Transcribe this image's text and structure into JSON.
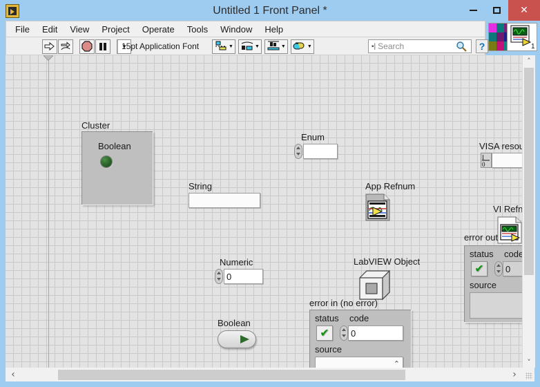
{
  "window": {
    "title": "Untitled 1 Front Panel *",
    "app_icon": "labview-vi-icon",
    "minimize": "–",
    "maximize": "□",
    "close": "✕"
  },
  "menu": {
    "items": [
      "File",
      "Edit",
      "View",
      "Project",
      "Operate",
      "Tools",
      "Window",
      "Help"
    ]
  },
  "toolbar": {
    "run_label": "run-arrow-icon",
    "run_continuous_label": "run-continuously-icon",
    "abort_label": "abort-execution-icon",
    "pause_label": "pause-icon",
    "font_selector": "15pt Application Font",
    "font_caret": "▼",
    "align_objects": "align-objects-icon",
    "distribute_objects": "distribute-objects-icon",
    "resize_objects": "resize-objects-icon",
    "reorder_objects": "reorder-objects-icon",
    "search": {
      "placeholder": "Search",
      "icon": "magnifier-icon"
    },
    "help_button": "?",
    "palette_icon": "color-palette-icon",
    "context_help_icon": "context-help-icon",
    "context_help_number": "1"
  },
  "canvas": {
    "controls": [
      {
        "name": "cluster",
        "label": "Cluster"
      },
      {
        "name": "cluster-boolean",
        "label": "Boolean"
      },
      {
        "name": "string",
        "label": "String",
        "value": ""
      },
      {
        "name": "numeric",
        "label": "Numeric",
        "value": "0"
      },
      {
        "name": "boolean-switch",
        "label": "Boolean"
      },
      {
        "name": "enum",
        "label": "Enum",
        "value": ""
      },
      {
        "name": "app-refnum",
        "label": "App Refnum"
      },
      {
        "name": "labview-object",
        "label": "LabVIEW Object"
      },
      {
        "name": "error-in",
        "label": "error in (no error)"
      },
      {
        "name": "visa-resource",
        "label": "VISA resour"
      },
      {
        "name": "vi-refnum",
        "label": "VI Refn"
      },
      {
        "name": "error-out",
        "label": "error out"
      }
    ],
    "error_in": {
      "title": "error in (no error)",
      "status_label": "status",
      "status_value": "✔",
      "code_label": "code",
      "code_value": "0",
      "source_label": "source",
      "source_value": ""
    },
    "error_out": {
      "title": "error out",
      "status_label": "status",
      "status_value": "✔",
      "code_label": "code",
      "code_value": "0",
      "source_label": "source",
      "source_value": ""
    },
    "visa_resource": {
      "label": "VISA resour",
      "value": "",
      "glyph": "I/O"
    },
    "vi_refnum": {
      "label": "VI Refn"
    }
  },
  "scrollbars": {
    "h_left_arrow": "‹",
    "h_right_arrow": "›",
    "v_up_arrow": "˄",
    "v_down_arrow": "˅"
  }
}
